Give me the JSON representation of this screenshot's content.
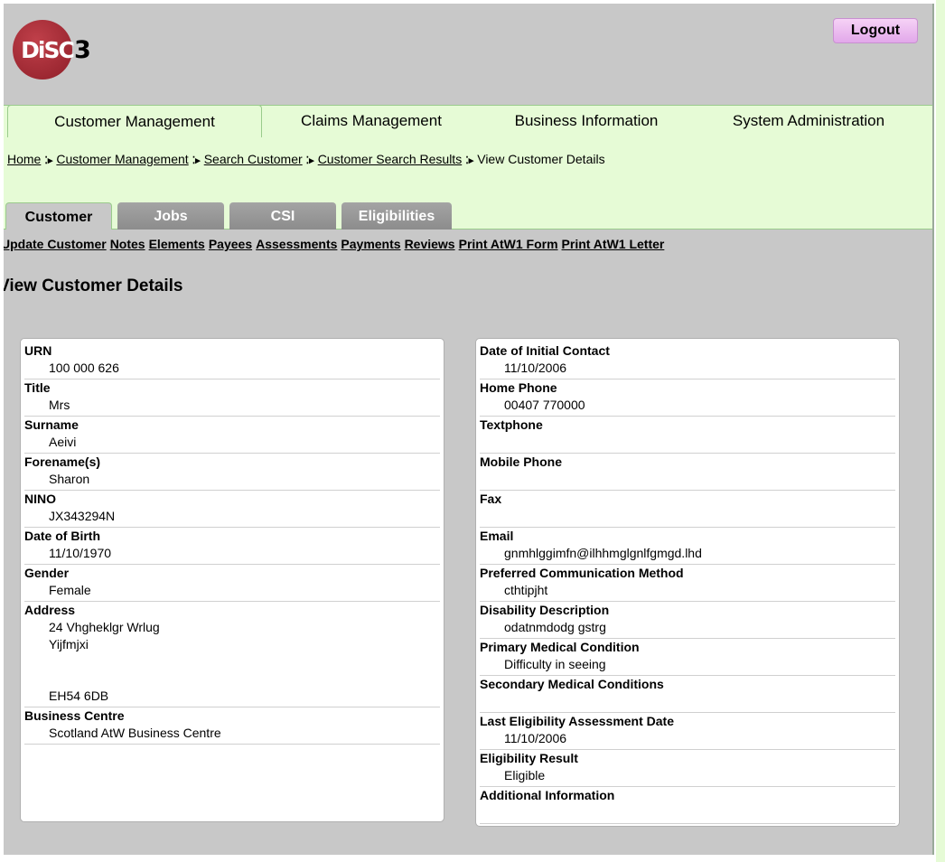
{
  "logo": {
    "text": "DiSC",
    "number": "3"
  },
  "logout_label": "Logout",
  "main_tabs": [
    {
      "label": "Customer Management",
      "active": true
    },
    {
      "label": "Claims Management",
      "active": false
    },
    {
      "label": "Business Information",
      "active": false
    },
    {
      "label": "System Administration",
      "active": false
    }
  ],
  "breadcrumb": {
    "items": [
      "Home",
      "Customer Management",
      "Search Customer",
      "Customer Search Results"
    ],
    "current": "View Customer Details"
  },
  "sub_tabs": [
    {
      "label": "Customer",
      "active": true
    },
    {
      "label": "Jobs",
      "active": false
    },
    {
      "label": "CSI",
      "active": false
    },
    {
      "label": "Eligibilities",
      "active": false
    }
  ],
  "actions": [
    "Update Customer",
    "Notes",
    "Elements",
    "Payees",
    "Assessments",
    "Payments",
    "Reviews",
    "Print AtW1 Form",
    "Print AtW1 Letter"
  ],
  "page_title": "View Customer Details",
  "left_fields": [
    {
      "label": "URN",
      "value": [
        "100 000 626"
      ]
    },
    {
      "label": "Title",
      "value": [
        "Mrs"
      ]
    },
    {
      "label": "Surname",
      "value": [
        "Aeivi"
      ]
    },
    {
      "label": "Forename(s)",
      "value": [
        "Sharon"
      ]
    },
    {
      "label": "NINO",
      "value": [
        "JX343294N"
      ]
    },
    {
      "label": "Date of Birth",
      "value": [
        "11/10/1970"
      ]
    },
    {
      "label": "Gender",
      "value": [
        "Female"
      ]
    },
    {
      "label": "Address",
      "value": [
        "24 Vhgheklgr Wrlug",
        "Yijfmjxi",
        "",
        "",
        "EH54 6DB"
      ]
    },
    {
      "label": "Business Centre",
      "value": [
        "Scotland AtW Business Centre"
      ]
    }
  ],
  "right_fields": [
    {
      "label": "Date of Initial Contact",
      "value": [
        "11/10/2006"
      ]
    },
    {
      "label": "Home Phone",
      "value": [
        "00407 770000"
      ]
    },
    {
      "label": "Textphone",
      "value": [
        ""
      ]
    },
    {
      "label": "Mobile Phone",
      "value": [
        ""
      ]
    },
    {
      "label": "Fax",
      "value": [
        ""
      ]
    },
    {
      "label": "Email",
      "value": [
        "gnmhlggimfn@ilhhmglgnlfgmgd.lhd"
      ]
    },
    {
      "label": "Preferred Communication Method",
      "value": [
        "cthtipjht"
      ]
    },
    {
      "label": "Disability Description",
      "value": [
        "odatnmdodg gstrg"
      ]
    },
    {
      "label": "Primary Medical Condition",
      "value": [
        "Difficulty in seeing"
      ]
    },
    {
      "label": "Secondary Medical Conditions",
      "value": [
        ""
      ]
    },
    {
      "label": "Last Eligibility Assessment Date",
      "value": [
        "11/10/2006"
      ]
    },
    {
      "label": "Eligibility Result",
      "value": [
        "Eligible"
      ]
    },
    {
      "label": "Additional Information",
      "value": [
        ""
      ]
    }
  ],
  "colors": {
    "header_bg": "#c8c8c8",
    "nav_bg": "#e6fbd6",
    "logo_red": "#8e1e28",
    "logout_pink": "#f0c6f4",
    "inactive_tab": "#999999"
  }
}
